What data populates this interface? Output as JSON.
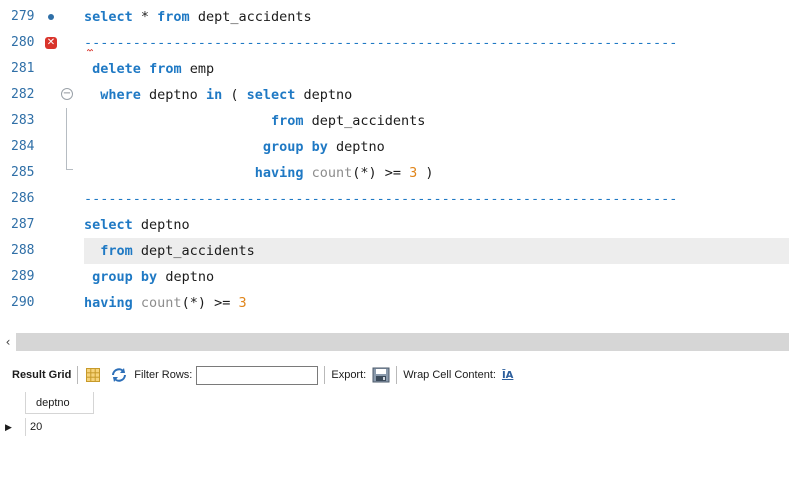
{
  "editor": {
    "lines": [
      {
        "num": "279",
        "marker": "dot",
        "tokens": [
          [
            "kw",
            "select"
          ],
          [
            "t",
            " * "
          ],
          [
            "kw",
            "from"
          ],
          [
            "t",
            " dept_accidents"
          ]
        ]
      },
      {
        "num": "280",
        "marker": "error",
        "tokens": [
          [
            "dash",
            "-------------------------------------------------------------------------"
          ]
        ]
      },
      {
        "num": "281",
        "tokens": [
          [
            "t",
            " "
          ],
          [
            "kw",
            "delete"
          ],
          [
            "t",
            " "
          ],
          [
            "kw",
            "from"
          ],
          [
            "t",
            " emp"
          ]
        ]
      },
      {
        "num": "282",
        "fold": "open",
        "tokens": [
          [
            "t",
            "  "
          ],
          [
            "kw",
            "where"
          ],
          [
            "t",
            " deptno "
          ],
          [
            "kw",
            "in"
          ],
          [
            "t",
            " ( "
          ],
          [
            "kw",
            "select"
          ],
          [
            "t",
            " deptno"
          ]
        ]
      },
      {
        "num": "283",
        "tokens": [
          [
            "t",
            "                       "
          ],
          [
            "kw",
            "from"
          ],
          [
            "t",
            " dept_accidents"
          ]
        ]
      },
      {
        "num": "284",
        "tokens": [
          [
            "t",
            "                      "
          ],
          [
            "kw",
            "group"
          ],
          [
            "t",
            " "
          ],
          [
            "kw",
            "by"
          ],
          [
            "t",
            " deptno"
          ]
        ]
      },
      {
        "num": "285",
        "tokens": [
          [
            "t",
            "                     "
          ],
          [
            "kw",
            "having"
          ],
          [
            "t",
            " "
          ],
          [
            "fn",
            "count"
          ],
          [
            "t",
            "(*) >= "
          ],
          [
            "num",
            "3"
          ],
          [
            "t",
            " )"
          ]
        ]
      },
      {
        "num": "286",
        "tokens": [
          [
            "dash",
            "-------------------------------------------------------------------------"
          ]
        ]
      },
      {
        "num": "287",
        "tokens": [
          [
            "kw",
            "select"
          ],
          [
            "t",
            " deptno"
          ]
        ]
      },
      {
        "num": "288",
        "current": true,
        "tokens": [
          [
            "t",
            "  "
          ],
          [
            "kw",
            "from"
          ],
          [
            "t",
            " dept_accidents"
          ]
        ]
      },
      {
        "num": "289",
        "tokens": [
          [
            "t",
            " "
          ],
          [
            "kw",
            "group"
          ],
          [
            "t",
            " "
          ],
          [
            "kw",
            "by"
          ],
          [
            "t",
            " deptno"
          ]
        ]
      },
      {
        "num": "290",
        "tokens": [
          [
            "kw",
            "having"
          ],
          [
            "t",
            " "
          ],
          [
            "fn",
            "count"
          ],
          [
            "t",
            "(*) >= "
          ],
          [
            "num",
            "3"
          ]
        ]
      }
    ]
  },
  "scrollbar": {
    "left_arrow": "‹"
  },
  "toolbar": {
    "result_grid_label": "Result Grid",
    "filter_label": "Filter Rows:",
    "filter_value": "",
    "export_label": "Export:",
    "wrap_label": "Wrap Cell Content:",
    "wrap_icon_text": "ĪA",
    "grid_icon": "grid-layout-icon",
    "refresh_icon": "refresh-icon",
    "export_icon": "export-icon"
  },
  "grid": {
    "columns": [
      "deptno"
    ],
    "rows": [
      [
        "20"
      ]
    ],
    "row_indicator": "▶"
  },
  "colors": {
    "keyword": "#1f79c4",
    "function": "#8d8d8d",
    "number": "#e0851a",
    "line_number": "#2f6fa7",
    "error_marker": "#d9342b"
  }
}
